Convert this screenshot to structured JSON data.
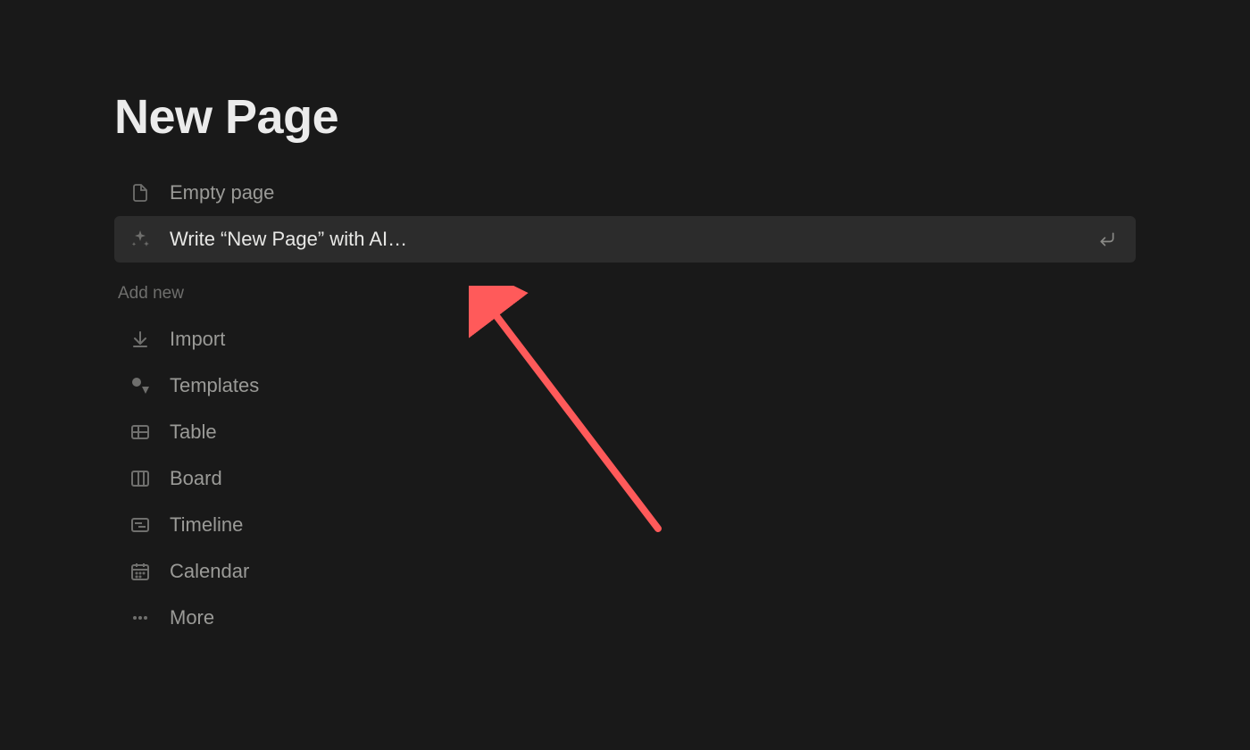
{
  "page": {
    "title": "New Page"
  },
  "top_menu": [
    {
      "id": "empty",
      "label": "Empty page",
      "icon": "page-icon"
    },
    {
      "id": "ai",
      "label": "Write “New Page” with AI…",
      "icon": "sparkle-icon",
      "highlighted": true,
      "enter": true
    }
  ],
  "section": {
    "header": "Add new"
  },
  "add_menu": [
    {
      "id": "import",
      "label": "Import",
      "icon": "download-icon"
    },
    {
      "id": "templates",
      "label": "Templates",
      "icon": "shapes-icon"
    },
    {
      "id": "table",
      "label": "Table",
      "icon": "table-icon"
    },
    {
      "id": "board",
      "label": "Board",
      "icon": "board-icon"
    },
    {
      "id": "timeline",
      "label": "Timeline",
      "icon": "timeline-icon"
    },
    {
      "id": "calendar",
      "label": "Calendar",
      "icon": "calendar-icon"
    },
    {
      "id": "more",
      "label": "More",
      "icon": "more-icon"
    }
  ],
  "annotation": {
    "arrow_color": "#ff5a5a"
  }
}
